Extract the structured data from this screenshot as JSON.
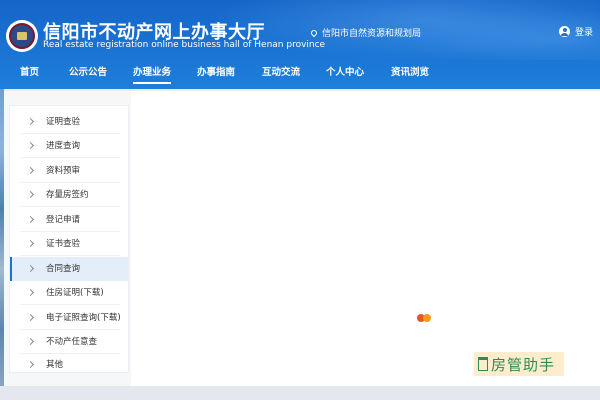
{
  "header": {
    "title": "信阳市不动产网上办事大厅",
    "subtitle": "Real estate registration online business hall of Henan province",
    "location": "信阳市自然资源和规划局",
    "login_label": "登录"
  },
  "nav": {
    "items": [
      {
        "label": "首页"
      },
      {
        "label": "公示公告"
      },
      {
        "label": "办理业务",
        "active": true
      },
      {
        "label": "办事指南"
      },
      {
        "label": "互动交流"
      },
      {
        "label": "个人中心"
      },
      {
        "label": "资讯浏览"
      }
    ]
  },
  "sidebar": {
    "items": [
      {
        "label": "证明查验"
      },
      {
        "label": "进度查询"
      },
      {
        "label": "资料预审"
      },
      {
        "label": "存量房签约"
      },
      {
        "label": "登记申请"
      },
      {
        "label": "证书查验"
      },
      {
        "label": "合同查询",
        "active": true
      },
      {
        "label": "住房证明(下载)"
      },
      {
        "label": "电子证照查询(下载)"
      },
      {
        "label": "不动产任意查"
      },
      {
        "label": "其他"
      }
    ]
  },
  "watermark": {
    "text": "房管助手"
  },
  "colors": {
    "header_blue": "#1a73d3",
    "active_highlight": "#e4eefb",
    "loader_red": "#e8542b",
    "loader_orange": "#f39a1d"
  }
}
